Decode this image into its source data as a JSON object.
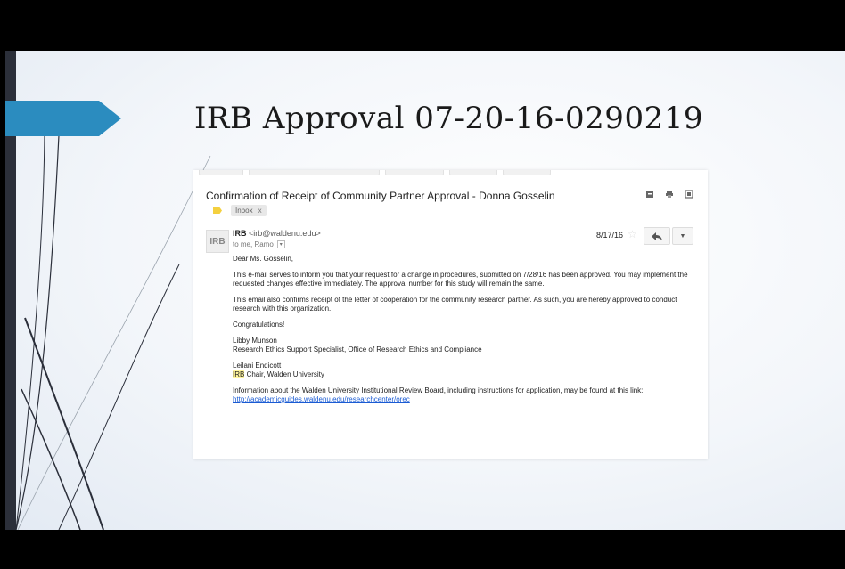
{
  "slide": {
    "title": "IRB Approval 07-20-16-0290219"
  },
  "email": {
    "subject": "Confirmation of Receipt of Community Partner Approval - Donna Gosselin",
    "label_chip": "Inbox",
    "label_chip_close": "x",
    "avatar_text": "IRB",
    "sender_name": "IRB",
    "sender_address": "<irb@waldenu.edu>",
    "recipients": "to me, Ramo",
    "date": "8/17/16",
    "greeting": "Dear Ms. Gosselin,",
    "paragraph1": "This e-mail serves to inform you that your request for a change in procedures, submitted on 7/28/16 has been approved. You may implement the requested changes effective immediately. The approval number for this study will remain the same.",
    "paragraph2": "This email also confirms receipt of the letter of cooperation for the community research partner. As such, you are hereby approved to conduct research with this organization.",
    "congrats": "Congratulations!",
    "sig1_name": "Libby Munson",
    "sig1_title": "Research Ethics Support Specialist, Office of Research Ethics and Compliance",
    "sig2_name": "Leilani Endicott",
    "sig2_title_highlight": "IRB",
    "sig2_title_rest": " Chair, Walden University",
    "info_text": "Information about the Walden University Institutional Review Board, including instructions for application,  may be found at this link: ",
    "info_link": "http://academicguides.waldenu.edu/researchcenter/orec"
  },
  "icons": {
    "archive": "archive-icon",
    "print": "print-icon",
    "new_window": "new-window-icon",
    "label_tag": "tag-icon",
    "star": "star-icon",
    "reply": "reply-icon",
    "more": "chevron-down-icon"
  },
  "colors": {
    "accent_arrow": "#2b8cbf",
    "link": "#1a5bd3",
    "label_tag": "#f4d03f"
  }
}
